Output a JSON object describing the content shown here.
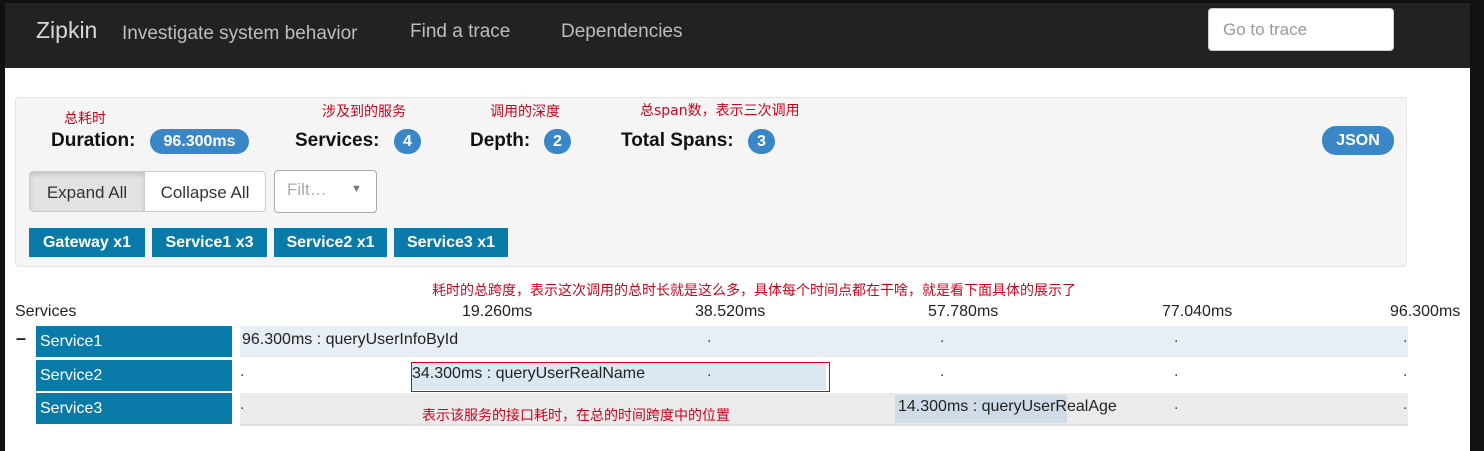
{
  "navbar": {
    "brand": "Zipkin",
    "tagline": "Investigate system behavior",
    "links": [
      "Find a trace",
      "Dependencies"
    ],
    "goto_placeholder": "Go to trace"
  },
  "annotations": {
    "duration": "总耗时",
    "services": "涉及到的服务",
    "depth": "调用的深度",
    "spans": "总span数，表示三次调用",
    "timeline": "耗时的总跨度，表示这次调用的总时长就是这么多，具体每个时间点都在干啥，就是看下面具体的展示了",
    "position": "表示该服务的接口耗时，在总的时间跨度中的位置"
  },
  "summary": {
    "duration_label": "Duration:",
    "duration_value": "96.300ms",
    "services_label": "Services:",
    "services_value": "4",
    "depth_label": "Depth:",
    "depth_value": "2",
    "spans_label": "Total Spans:",
    "spans_value": "3",
    "json_label": "JSON"
  },
  "controls": {
    "expand_all": "Expand All",
    "collapse_all": "Collapse All",
    "filter_placeholder": "Filt…"
  },
  "service_tags": [
    "Gateway x1",
    "Service1 x3",
    "Service2 x1",
    "Service3 x1"
  ],
  "timeline": {
    "services_header": "Services",
    "ticks": [
      "19.260ms",
      "38.520ms",
      "57.780ms",
      "77.040ms",
      "96.300ms"
    ],
    "collapse_symbol": "–",
    "rows": [
      {
        "service": "Service1",
        "span_label": "96.300ms : queryUserInfoById",
        "start_fraction": 0.0,
        "duration_fraction": 1.0
      },
      {
        "service": "Service2",
        "span_label": "34.300ms : queryUserRealName",
        "start_fraction": 0.15,
        "duration_fraction": 0.356
      },
      {
        "service": "Service3",
        "span_label": "14.300ms : queryUserRealAge",
        "start_fraction": 0.562,
        "duration_fraction": 0.148
      }
    ]
  },
  "colors": {
    "navbar": "#222222",
    "badge": "#3a87c8",
    "service_tag": "#0a7ba8",
    "annotation": "#d0021b"
  }
}
